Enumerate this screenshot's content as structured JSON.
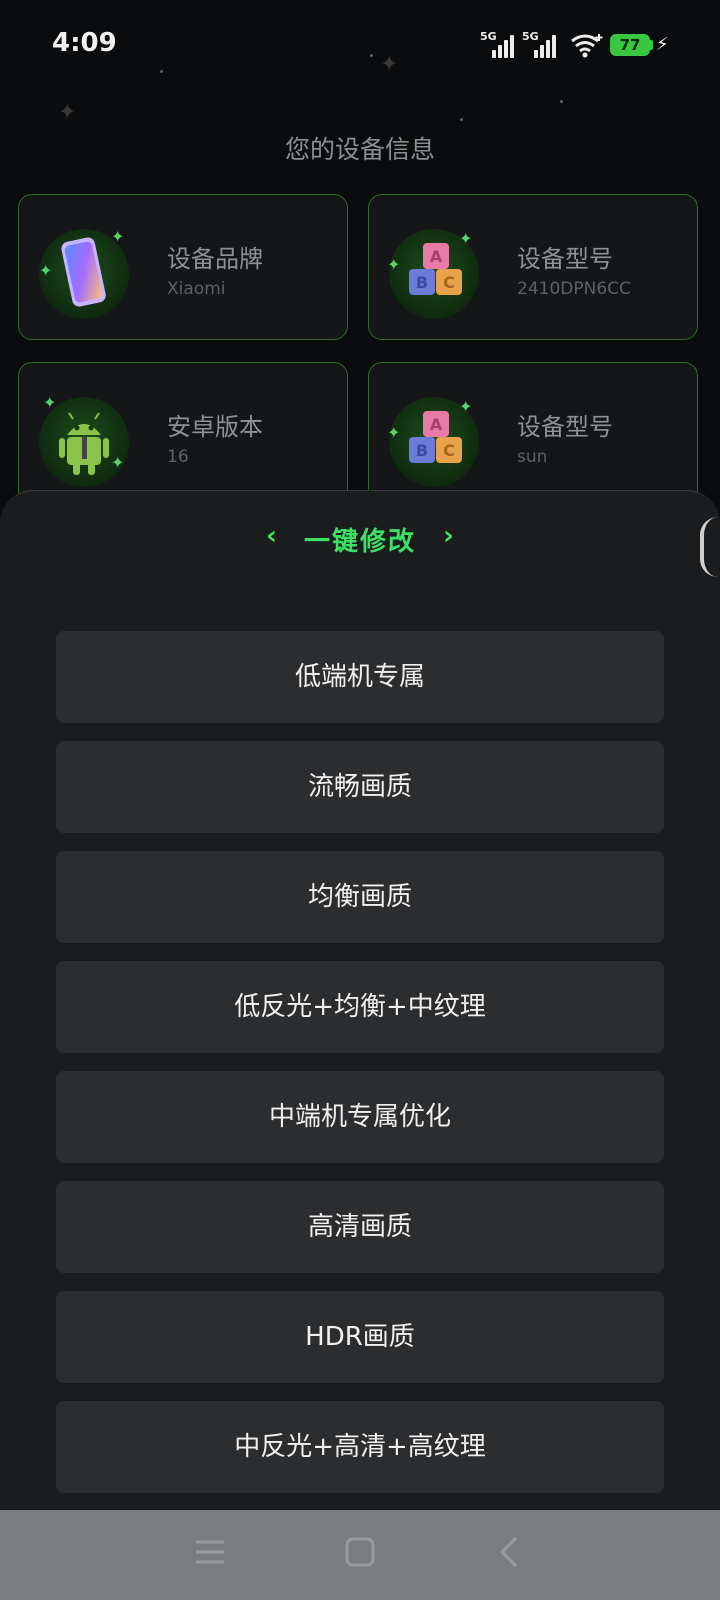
{
  "status_bar": {
    "time": "4:09",
    "signal_1_label": "5G",
    "signal_2_label": "5G",
    "battery_level": "77",
    "charging": true
  },
  "page_title": "您的设备信息",
  "device_cards": [
    {
      "title": "设备品牌",
      "value": "Xiaomi",
      "icon": "phone-icon"
    },
    {
      "title": "设备型号",
      "value": "2410DPN6CC",
      "icon": "abc-blocks-icon"
    },
    {
      "title": "安卓版本",
      "value": "16",
      "icon": "android-robot-icon"
    },
    {
      "title": "设备型号",
      "value": "sun",
      "icon": "abc-blocks-icon"
    }
  ],
  "sheet": {
    "title": "一键修改",
    "left_chevron": "‹",
    "right_chevron": "›",
    "options": [
      "低端机专属",
      "流畅画质",
      "均衡画质",
      "低反光+均衡+中纹理",
      "中端机专属优化",
      "高清画质",
      "HDR画质",
      "中反光+高清+高纹理"
    ]
  },
  "nav_bar": {
    "icons": [
      "menu-icon",
      "home-square-icon",
      "back-chevron-icon"
    ]
  },
  "colors": {
    "accent_green": "#3ee063",
    "card_border": "#2e6a2a",
    "button_bg": "#2c2d2f",
    "sheet_bg": "#1b1c1e",
    "battery": "#39c742"
  }
}
